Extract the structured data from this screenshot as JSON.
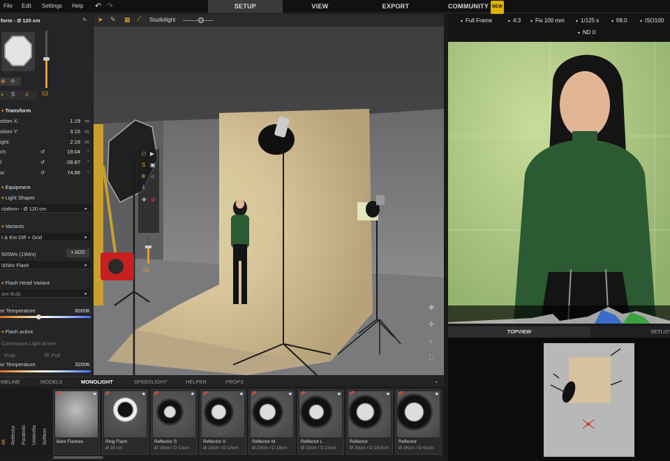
{
  "menu": {
    "file": "File",
    "edit": "Edit",
    "settings": "Settings",
    "help": "Help"
  },
  "tabs": {
    "setup": "SETUP",
    "view": "VIEW",
    "export": "EXPORT",
    "community": "COMMUNITY",
    "new_badge": "NEW"
  },
  "left": {
    "shaper_title": "form - Ø 120 cm",
    "slider_value": "53",
    "transform_head": "Transform",
    "pos_x_label": "sition X:",
    "pos_x": "1.19",
    "pos_x_unit": "m",
    "pos_y_label": "sition Y:",
    "pos_y": "3.15",
    "pos_y_unit": "m",
    "height_label": "ight:",
    "height": "2.16",
    "height_unit": "m",
    "pitch_label": "ch:",
    "pitch": "19.04",
    "pitch_unit": "°",
    "roll_label": "l:",
    "roll": "-28.87",
    "roll_unit": "°",
    "yaw_label": "w:",
    "yaw": "74.66",
    "yaw_unit": "°",
    "equipment_head": "Equipment",
    "light_shaper_label": "Light Shaper",
    "light_shaper_value": "ctaform - Ø 120 cm",
    "variants_head": "Variants",
    "variants_value": "t & Ext Diff + Grid",
    "flash_power_label": "500Ws (19Ws)",
    "add_button": "ADD",
    "flash_value": "00Ws Flash",
    "flash_head_variant": "Flash Head Variant",
    "bulb_value": "are Bulb",
    "color_temp_label": "or Temperature",
    "color_temp_value": "6000K",
    "flash_active": "Flash active",
    "continuous_light": "Continuous Light active",
    "prop_label": "Prop",
    "full_label": "Full",
    "color_temp2_label": "or Temperature",
    "color_temp2_value": "3200K"
  },
  "viewport": {
    "mode_label": "Studiolight",
    "overlay_slider_value": "53"
  },
  "camera": {
    "frame": "Full Frame",
    "ratio": "4:3",
    "lens": "Fix 100 mm",
    "shutter": "1/125 s",
    "aperture": "f/8.0",
    "iso": "ISO100",
    "nd": "ND 0"
  },
  "right_tabs": {
    "topview": "TOPVIEW",
    "setlist": "SETLIST"
  },
  "bottom_tabs": [
    "MELINE",
    "MODELS",
    "MONOLIGHT",
    "SPEEDLIGHT",
    "HELPER",
    "PROPS"
  ],
  "categories": [
    "All",
    "Reflector",
    "Parabolic",
    "Umbrella",
    "Softbox"
  ],
  "shelf": [
    {
      "name": "Bare Flashes",
      "dims": ""
    },
    {
      "name": "Ring Flash",
      "dims": "Ø 30 cm"
    },
    {
      "name": "Reflector S",
      "dims": "Ø 16cm / D 13cm"
    },
    {
      "name": "Reflector S",
      "dims": "Ø 23cm / D 13cm"
    },
    {
      "name": "Reflector M",
      "dims": "Ø 23cm / D 18cm"
    },
    {
      "name": "Reflector L",
      "dims": "Ø 23cm / D 23cm"
    },
    {
      "name": "Reflector",
      "dims": "Ø 30cm / D 18,5cm"
    },
    {
      "name": "Reflector",
      "dims": "Ø 34cm / D 41cm"
    }
  ],
  "colors": {
    "accent": "#e89a2a",
    "active_tab": "#3a3a3c",
    "backdrop": "#d9c49a",
    "sweater": "#2c5a32"
  }
}
